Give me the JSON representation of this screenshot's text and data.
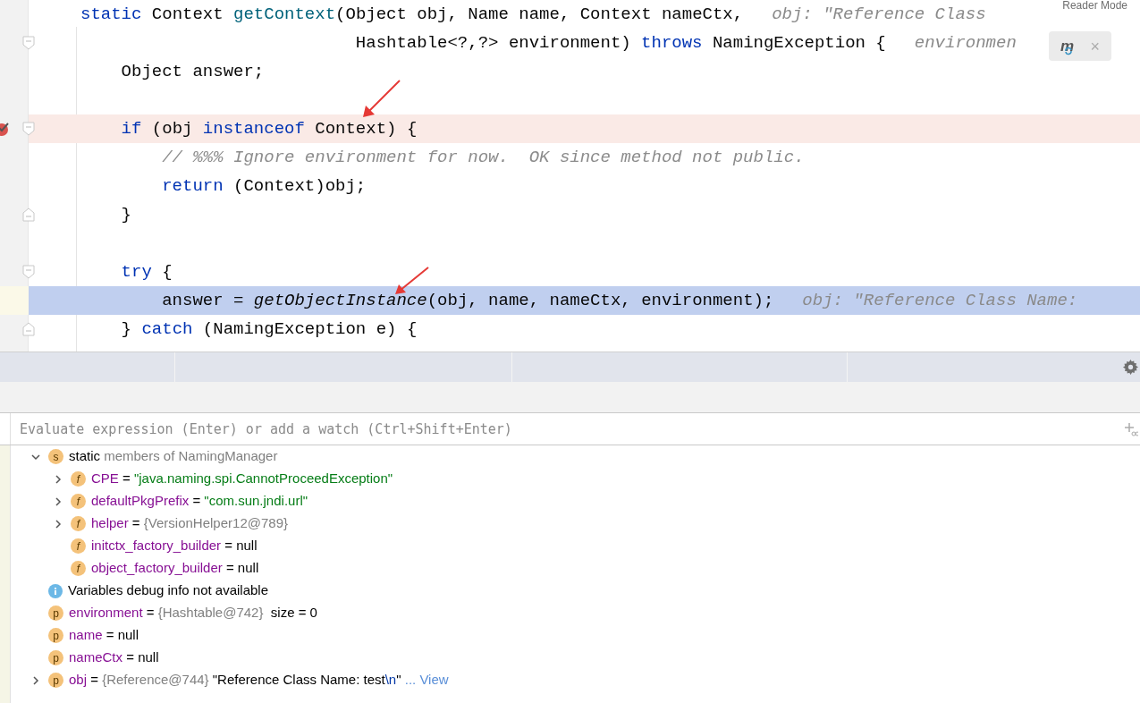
{
  "reader_mode": {
    "label": "Reader Mode"
  },
  "code_lines": [
    {
      "kind": "plain",
      "fold_start": false,
      "fold_end": false,
      "tokens": [
        {
          "kind": "keyword",
          "text": "static "
        },
        {
          "kind": "plain",
          "text": "Context "
        },
        {
          "kind": "method",
          "text": "getContext"
        },
        {
          "kind": "plain",
          "text": "(Object obj, Name name, Context nameCtx,"
        },
        {
          "kind": "hint",
          "text": "obj: \"Reference Class"
        }
      ]
    },
    {
      "kind": "plain",
      "fold_start": true,
      "fold_end": false,
      "tokens": [
        {
          "kind": "plain",
          "text": "                           Hashtable<?,?> environment) "
        },
        {
          "kind": "keyword",
          "text": "throws "
        },
        {
          "kind": "plain",
          "text": "NamingException {"
        },
        {
          "kind": "hint",
          "text": "environmen"
        }
      ]
    },
    {
      "kind": "plain",
      "fold_start": false,
      "fold_end": false,
      "tokens": [
        {
          "kind": "plain",
          "text": "    Object answer;"
        }
      ]
    },
    {
      "kind": "plain",
      "fold_start": false,
      "fold_end": false
    },
    {
      "kind": "breakpoint",
      "fold_start": true,
      "fold_end": false,
      "tokens": [
        {
          "kind": "keyword",
          "text": "    if "
        },
        {
          "kind": "plain",
          "text": "(obj "
        },
        {
          "kind": "keyword",
          "text": "instanceof "
        },
        {
          "kind": "plain",
          "text": "Context) {"
        }
      ]
    },
    {
      "kind": "plain",
      "fold_start": false,
      "fold_end": false,
      "tokens": [
        {
          "kind": "comment",
          "text": "        // %%% Ignore environment for now.  OK since method not public."
        }
      ]
    },
    {
      "kind": "plain",
      "fold_start": false,
      "fold_end": false,
      "tokens": [
        {
          "kind": "keyword",
          "text": "        return "
        },
        {
          "kind": "plain",
          "text": "(Context)obj;"
        }
      ]
    },
    {
      "kind": "plain",
      "fold_start": false,
      "fold_end": true,
      "tokens": [
        {
          "kind": "plain",
          "text": "    }"
        }
      ]
    },
    {
      "kind": "plain",
      "fold_start": false,
      "fold_end": false
    },
    {
      "kind": "plain",
      "fold_start": true,
      "fold_end": false,
      "tokens": [
        {
          "kind": "keyword",
          "text": "    try "
        },
        {
          "kind": "plain",
          "text": "{"
        }
      ]
    },
    {
      "kind": "execution",
      "fold_start": false,
      "fold_end": false,
      "tokens": [
        {
          "kind": "plain",
          "text": "        answer = "
        },
        {
          "kind": "call",
          "text": "getObjectInstance"
        },
        {
          "kind": "plain",
          "text": "(obj, name, nameCtx, environment);"
        },
        {
          "kind": "hint",
          "text": "obj: \"Reference Class Name:"
        }
      ]
    },
    {
      "kind": "plain",
      "fold_start": false,
      "fold_end": true,
      "tokens": [
        {
          "kind": "plain",
          "text": "    } "
        },
        {
          "kind": "keyword",
          "text": "catch "
        },
        {
          "kind": "plain",
          "text": "(NamingException e) {"
        }
      ]
    }
  ],
  "popup": {
    "letter": "m",
    "close": "×"
  },
  "evaluate": {
    "placeholder": "Evaluate expression (Enter) or add a watch (Ctrl+Shift+Enter)"
  },
  "variables": [
    {
      "kind": "static",
      "badge": "s",
      "expanded": true,
      "segments": [
        {
          "kind": "plain",
          "text": "static"
        },
        {
          "kind": "muted",
          "text": " members of NamingManager"
        }
      ],
      "children": [
        {
          "kind": "field",
          "badge": "f",
          "expanded": false,
          "segments": [
            {
              "kind": "name",
              "text": "CPE"
            },
            {
              "kind": "plain",
              "text": " = "
            },
            {
              "kind": "string",
              "text": "\"java.naming.spi.CannotProceedException\""
            }
          ]
        },
        {
          "kind": "field",
          "badge": "f",
          "expanded": false,
          "segments": [
            {
              "kind": "name",
              "text": "defaultPkgPrefix"
            },
            {
              "kind": "plain",
              "text": " = "
            },
            {
              "kind": "string",
              "text": "\"com.sun.jndi.url\""
            }
          ]
        },
        {
          "kind": "field",
          "badge": "f",
          "expanded": false,
          "segments": [
            {
              "kind": "name",
              "text": "helper"
            },
            {
              "kind": "plain",
              "text": " = "
            },
            {
              "kind": "muted",
              "text": "{VersionHelper12@789}"
            }
          ]
        },
        {
          "kind": "field",
          "badge": "f",
          "segments": [
            {
              "kind": "name",
              "text": "initctx_factory_builder"
            },
            {
              "kind": "plain",
              "text": " = null"
            }
          ]
        },
        {
          "kind": "field",
          "badge": "f",
          "segments": [
            {
              "kind": "name",
              "text": "object_factory_builder"
            },
            {
              "kind": "plain",
              "text": " = null"
            }
          ]
        }
      ]
    },
    {
      "kind": "info",
      "segments": [
        {
          "kind": "plain",
          "text": "Variables debug info not available"
        }
      ]
    },
    {
      "kind": "param",
      "badge": "p",
      "segments": [
        {
          "kind": "name",
          "text": "environment"
        },
        {
          "kind": "plain",
          "text": " = "
        },
        {
          "kind": "muted",
          "text": "{Hashtable@742}"
        },
        {
          "kind": "plain",
          "text": "  size = 0"
        }
      ]
    },
    {
      "kind": "param",
      "badge": "p",
      "segments": [
        {
          "kind": "name",
          "text": "name"
        },
        {
          "kind": "plain",
          "text": " = null"
        }
      ]
    },
    {
      "kind": "param",
      "badge": "p",
      "segments": [
        {
          "kind": "name",
          "text": "nameCtx"
        },
        {
          "kind": "plain",
          "text": " = null"
        }
      ]
    },
    {
      "kind": "param",
      "badge": "p",
      "expanded": false,
      "segments": [
        {
          "kind": "name",
          "text": "obj"
        },
        {
          "kind": "plain",
          "text": " = "
        },
        {
          "kind": "muted",
          "text": "{Reference@744}"
        },
        {
          "kind": "plain",
          "text": " \"Reference Class Name: test"
        },
        {
          "kind": "escape",
          "text": "\\n"
        },
        {
          "kind": "plain",
          "text": "\""
        },
        {
          "kind": "link",
          "text": " ... View"
        }
      ]
    }
  ]
}
